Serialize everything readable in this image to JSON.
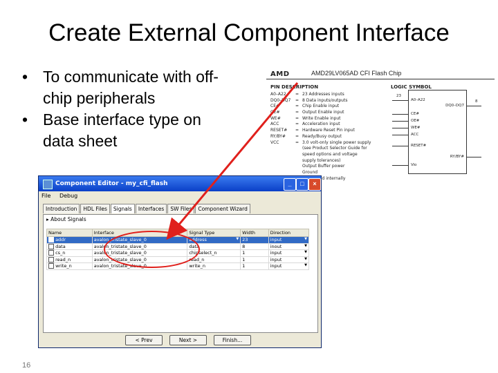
{
  "slide": {
    "title": "Create External Component Interface",
    "bullets": [
      "To communicate with off-chip peripherals",
      "Base interface type on data sheet"
    ],
    "page_number": "16"
  },
  "datasheet": {
    "brand": "AMD",
    "chip_name": "AMD29LV065AD  CFI Flash Chip",
    "pin_description_heading": "PIN DESCRIPTION",
    "logic_symbol_heading": "LOGIC SYMBOL",
    "pins": [
      {
        "pin": "A0–A22",
        "desc": "23 Addresses inputs"
      },
      {
        "pin": "DQ0–DQ7",
        "desc": "8 Data inputs/outputs"
      },
      {
        "pin": "CE#",
        "desc": "Chip Enable input"
      },
      {
        "pin": "OE#",
        "desc": "Output Enable input"
      },
      {
        "pin": "WE#",
        "desc": "Write Enable input"
      },
      {
        "pin": "ACC",
        "desc": "Acceleration input"
      },
      {
        "pin": "RESET#",
        "desc": "Hardware Reset Pin input"
      },
      {
        "pin": "RY/BY#",
        "desc": "Ready/Busy output"
      },
      {
        "pin": "VCC",
        "desc": "3.0 volt-only single power supply"
      },
      {
        "pin": "",
        "desc": "(see Product Selector Guide for"
      },
      {
        "pin": "",
        "desc": "speed options and voltage"
      },
      {
        "pin": "",
        "desc": "supply tolerances)"
      },
      {
        "pin": "",
        "desc": "Output Buffer power"
      },
      {
        "pin": "",
        "desc": "Ground"
      },
      {
        "pin": "",
        "desc": "Connected internally"
      }
    ],
    "symbol": {
      "addr_width": "23",
      "data_width": "8",
      "left_pins": [
        "A0–A22",
        "CE#",
        "OE#",
        "WE#",
        "ACC",
        "RESET#",
        "Vio"
      ],
      "right_pins": [
        "DQ0–DQ7",
        "RY/BY#"
      ]
    }
  },
  "window": {
    "title": "Component Editor - my_cfi_flash",
    "menu": [
      "File",
      "Debug"
    ],
    "tabs": [
      "Introduction",
      "HDL Files",
      "Signals",
      "Interfaces",
      "SW Files",
      "Component Wizard"
    ],
    "active_tab": "Signals",
    "section_label": "About Signals",
    "columns": [
      "Name",
      "Interface",
      "Signal Type",
      "Width",
      "Direction"
    ],
    "rows": [
      {
        "name": "addr",
        "interface": "avalon_tristate_slave_0",
        "type": "address",
        "width": "23",
        "direction": "input"
      },
      {
        "name": "data",
        "interface": "avalon_tristate_slave_0",
        "type": "data",
        "width": "8",
        "direction": "inout"
      },
      {
        "name": "cs_n",
        "interface": "avalon_tristate_slave_0",
        "type": "chipselect_n",
        "width": "1",
        "direction": "input"
      },
      {
        "name": "read_n",
        "interface": "avalon_tristate_slave_0",
        "type": "read_n",
        "width": "1",
        "direction": "input"
      },
      {
        "name": "write_n",
        "interface": "avalon_tristate_slave_0",
        "type": "write_n",
        "width": "1",
        "direction": "input"
      }
    ],
    "buttons": [
      "< Prev",
      "Next >",
      "Finish..."
    ]
  },
  "colors": {
    "highlight": "#e0201c",
    "selection": "#316ac5",
    "titlebar": "#0a3fc7"
  }
}
